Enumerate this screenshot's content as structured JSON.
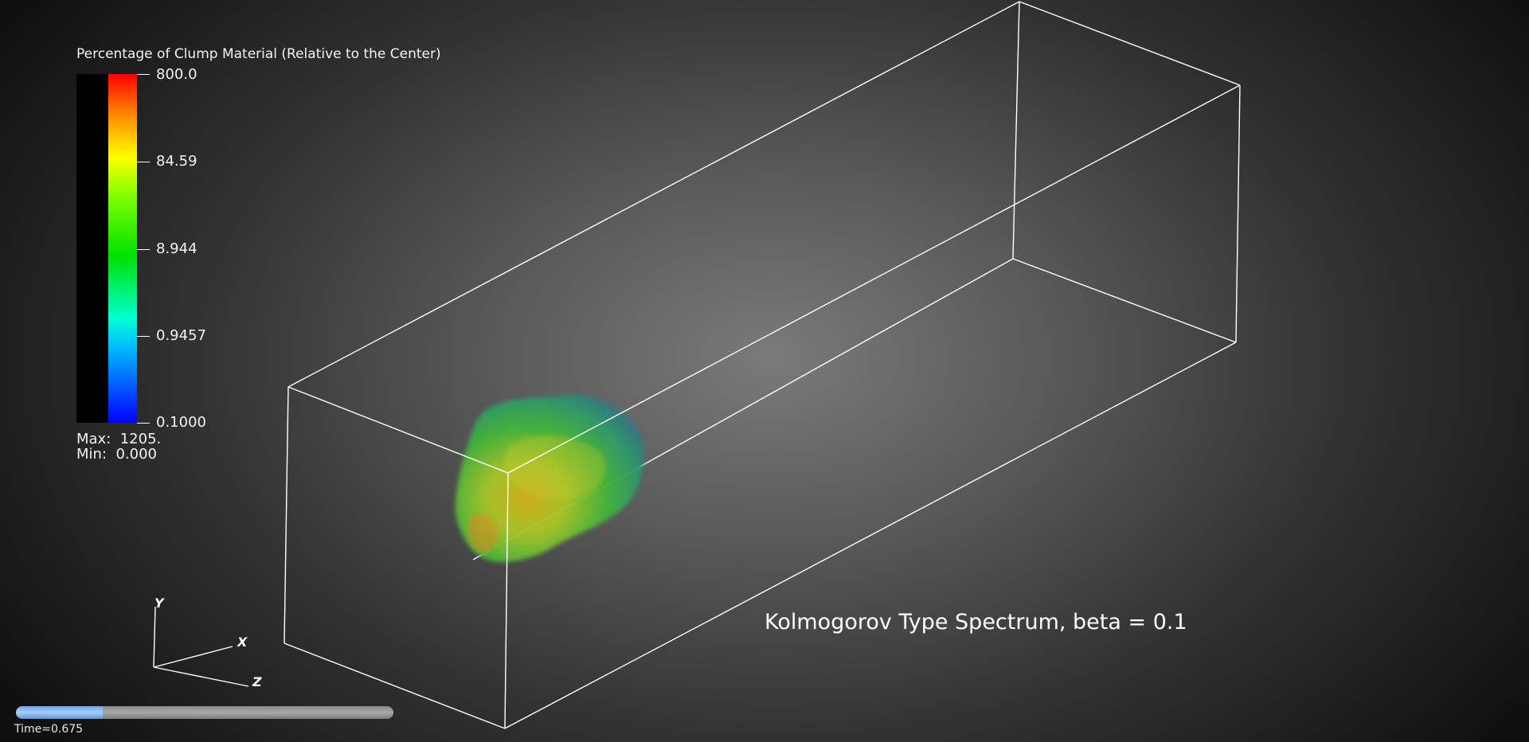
{
  "legend": {
    "title": "Percentage of Clump Material (Relative to the Center)",
    "ticks": [
      {
        "label": "800.0"
      },
      {
        "label": "84.59"
      },
      {
        "label": "8.944"
      },
      {
        "label": "0.9457"
      },
      {
        "label": "0.1000"
      }
    ],
    "max_text": "Max:  1205.",
    "min_text": "Min:  0.000",
    "colormap": [
      "#0000ff",
      "#00bfff",
      "#00e000",
      "#ffff00",
      "#ff8c00",
      "#ff0000"
    ]
  },
  "orientation_axes": {
    "x_label": "X",
    "y_label": "Y",
    "z_label": "Z"
  },
  "caption": "Kolmogorov Type Spectrum, beta = 0.1",
  "time": {
    "label": "Time=0.675",
    "progress": 0.23
  },
  "volume_icon": "clump-volume-render",
  "bounding_box_color": "#ffffff"
}
